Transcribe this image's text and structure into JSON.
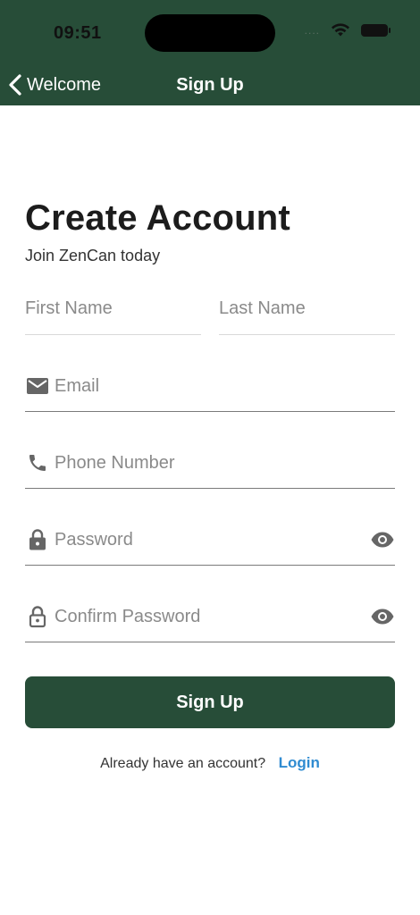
{
  "status_bar": {
    "time": "09:51",
    "signal_text": "....",
    "wifi_icon": "wifi-icon",
    "battery_icon": "battery-icon"
  },
  "nav": {
    "back_label": "Welcome",
    "title": "Sign Up"
  },
  "form": {
    "title": "Create Account",
    "subtitle": "Join ZenCan today",
    "first_name": {
      "placeholder": "First Name",
      "value": ""
    },
    "last_name": {
      "placeholder": "Last Name",
      "value": ""
    },
    "email": {
      "placeholder": "Email",
      "value": "",
      "icon": "email-icon"
    },
    "phone": {
      "placeholder": "Phone Number",
      "value": "",
      "icon": "phone-icon"
    },
    "password": {
      "placeholder": "Password",
      "value": "",
      "icon": "lock-icon"
    },
    "confirm_password": {
      "placeholder": "Confirm Password",
      "value": "",
      "icon": "lock-outline-icon"
    },
    "submit_label": "Sign Up",
    "footer_text": "Already have an account?",
    "login_label": "Login"
  },
  "colors": {
    "header_bg": "#274d38",
    "button_bg": "#274d38",
    "link": "#2f8bd1",
    "icon": "#666666",
    "placeholder": "#8a8a8a"
  }
}
